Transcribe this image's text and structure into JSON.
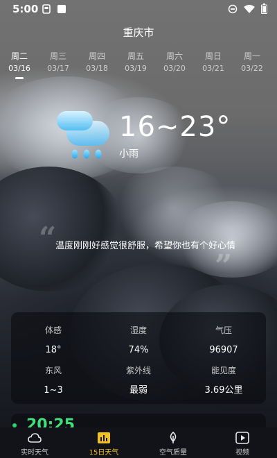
{
  "status_bar": {
    "time": "5:00"
  },
  "header": {
    "city": "重庆市"
  },
  "days": [
    {
      "name": "周二",
      "date": "03/16",
      "active": true
    },
    {
      "name": "周三",
      "date": "03/17"
    },
    {
      "name": "周四",
      "date": "03/18"
    },
    {
      "name": "周五",
      "date": "03/19"
    },
    {
      "name": "周六",
      "date": "03/20"
    },
    {
      "name": "周日",
      "date": "03/21"
    },
    {
      "name": "周一",
      "date": "03/22"
    }
  ],
  "weather": {
    "icon": "light-rain-cloud-icon",
    "temperature": "16~23°",
    "condition": "小雨"
  },
  "quote": {
    "text": "温度刚刚好感觉很舒服，希望你也有个好心情"
  },
  "details": [
    {
      "label": "体感",
      "value": "18°"
    },
    {
      "label": "湿度",
      "value": "74%"
    },
    {
      "label": "气压",
      "value": "96907"
    },
    {
      "label": "东风",
      "value": "1~3"
    },
    {
      "label": "紫外线",
      "value": "最弱"
    },
    {
      "label": "能见度",
      "value": "3.69公里"
    }
  ],
  "partial_card": {
    "text": "20:25"
  },
  "bottom_nav": [
    {
      "label": "实时天气",
      "icon": "cloud-icon"
    },
    {
      "label": "15日天气",
      "icon": "bar-chart-icon",
      "active": true
    },
    {
      "label": "空气质量",
      "icon": "leaf-icon"
    },
    {
      "label": "视频",
      "icon": "video-play-icon"
    }
  ],
  "colors": {
    "accent": "#f1c21b",
    "rain_icon": "#5cc8f5",
    "green": "#3fe07a"
  }
}
